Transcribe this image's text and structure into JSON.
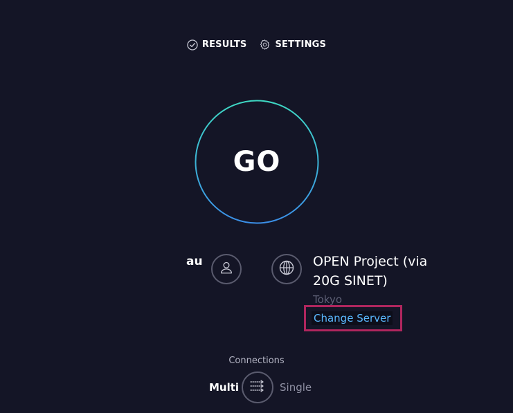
{
  "nav": {
    "results_label": "RESULTS",
    "settings_label": "SETTINGS"
  },
  "go_button": {
    "label": "GO"
  },
  "isp": {
    "name": "au"
  },
  "server": {
    "name": "OPEN Project (via 20G SINET)",
    "location": "Tokyo",
    "change_label": "Change Server"
  },
  "connections": {
    "label": "Connections",
    "multi_label": "Multi",
    "single_label": "Single"
  },
  "colors": {
    "background": "#141526",
    "go_ring_start": "#3ed8c3",
    "go_ring_end": "#3b8fe8",
    "link": "#5ab8ff",
    "highlight_box": "#b0265e"
  }
}
